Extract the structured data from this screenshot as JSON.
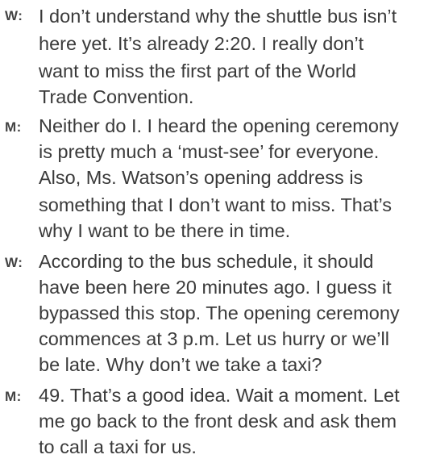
{
  "dialogue": [
    {
      "speaker": "W:",
      "lines": [
        "I don’t understand why the shuttle bus isn’t",
        "here yet. It’s already 2:20. I really don’t",
        "want to miss the first part of the World",
        "Trade Convention."
      ]
    },
    {
      "speaker": "M:",
      "lines": [
        "Neither do I. I heard the opening ceremony",
        "is pretty much a ‘must-see’ for everyone.",
        "Also, Ms. Watson’s opening address is",
        "something that I don’t want to miss. That’s",
        "why I want to be there in time."
      ]
    },
    {
      "speaker": "W:",
      "lines": [
        "According to the bus schedule, it should",
        "have been here 20 minutes ago. I guess it",
        "bypassed this stop. The opening ceremony",
        "commences at 3 p.m. Let us hurry or we’ll",
        "be late. Why don’t we take a taxi?"
      ]
    },
    {
      "speaker": "M:",
      "lines": [
        "49. That’s a good idea. Wait a moment. Let",
        "me go back to the front desk and ask them",
        "to call a taxi for us."
      ]
    }
  ]
}
